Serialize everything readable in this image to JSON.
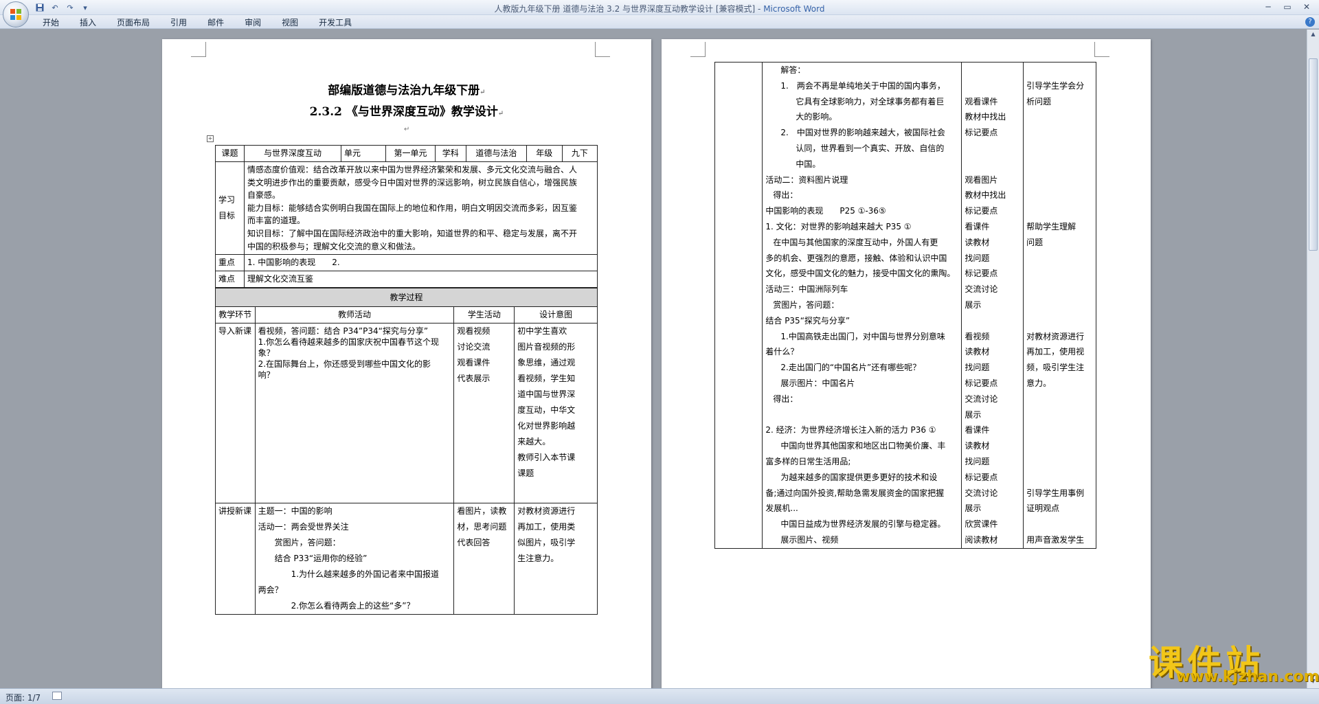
{
  "window": {
    "title_main": "人教版九年级下册 道德与法治 3.2 与世界深度互动教学设计 [兼容模式] - ",
    "title_brand": "Microsoft Word"
  },
  "menu": {
    "tabs": [
      "开始",
      "插入",
      "页面布局",
      "引用",
      "邮件",
      "审阅",
      "视图",
      "开发工具"
    ]
  },
  "status": {
    "page": "页面: 1/7"
  },
  "watermark": {
    "text": "课件站",
    "url": "www.kjzhan.com"
  },
  "page1": {
    "title": "部编版道德与法治九年级下册",
    "subtitle": "2.3.2 《与世界深度互动》教学设计",
    "table": {
      "topic_label": "课题",
      "topic_value": "与世界深度互动",
      "unit_label": "单元",
      "unit_value": "第一单元",
      "subject_label": "学科",
      "subject_value": "道德与法治",
      "grade_label": "年级",
      "grade_value": "九下",
      "goals_label_1": "学习",
      "goals_label_2": "目标",
      "goals": [
        "情感态度价值观：结合改革开放以来中国为世界经济繁荣和发展、多元文化交流与融合、人",
        "类文明进步作出的重要贡献，感受今日中国对世界的深远影响，树立民族自信心，增强民族",
        "自豪感。",
        "能力目标：能够结合实例明白我国在国际上的地位和作用，明白文明因交流而多彩，因互鉴",
        "而丰富的道理。",
        "知识目标：了解中国在国际经济政治中的重大影响，知道世界的和平、稳定与发展，离不开",
        "中国的积极参与；理解文化交流的意义和做法。"
      ],
      "key_label": "重点",
      "key_value": "1. 中国影响的表现　　2.",
      "diff_label": "难点",
      "diff_value": "理解文化交流互鉴",
      "process_header": "教学过程",
      "col_headers": [
        "教学环节",
        "教师活动",
        "学生活动",
        "设计意图"
      ],
      "row1": {
        "stage": "导入新课",
        "teacher": [
          "看视频，答问题：结合 P34”P34“探究与分享”",
          "1.你怎么看待越来越多的国家庆祝中国春节这个现",
          "象？",
          "2.在国际舞台上，你还感受到哪些中国文化的影",
          "响？",
          ""
        ],
        "student": [
          "观看视频",
          "讨论交流",
          "观看课件",
          "代表展示"
        ],
        "intent": [
          "初中学生喜欢",
          "图片音视频的形",
          "象思维，通过观",
          "看视频，学生知",
          "道中国与世界深",
          "度互动，中华文",
          "化对世界影响越",
          "来越大。",
          "教师引入本节课",
          "课题"
        ]
      },
      "row2": {
        "stage": "讲授新课",
        "teacher": [
          "主题一：中国的影响",
          "活动一：两会受世界关注",
          "　　赏图片，答问题：",
          "　　结合 P33“运用你的经验”",
          "　　　　1.为什么越来越多的外国记者来中国报道",
          "两会？",
          "　　　　2.你怎么看待两会上的这些“多”？"
        ],
        "student": [
          "看图片，读教",
          "材，思考问题",
          "代表回答",
          "",
          "",
          ""
        ],
        "intent": [
          "对教材资源进行",
          "再加工，使用类",
          "似图片，吸引学",
          "生注意力。",
          "",
          "",
          ""
        ]
      }
    }
  },
  "page2": {
    "rows": [
      {
        "t": "解答：",
        "i": 2,
        "s": "",
        "d": ""
      },
      {
        "t": "1.　两会不再是单纯地关于中国的国内事务，",
        "i": 2,
        "s": "",
        "d": "引导学生学会分"
      },
      {
        "t": "它具有全球影响力，对全球事务都有着巨",
        "i": 4,
        "s": "观看课件",
        "d": "析问题"
      },
      {
        "t": "大的影响。",
        "i": 4,
        "s": "教材中找出",
        "d": ""
      },
      {
        "t": "2.　中国对世界的影响越来越大，被国际社会",
        "i": 2,
        "s": "标记要点",
        "d": ""
      },
      {
        "t": "认同，世界看到一个真实、开放、自信的",
        "i": 4,
        "s": "",
        "d": ""
      },
      {
        "t": "中国。",
        "i": 4,
        "s": "",
        "d": ""
      },
      {
        "t": "活动二：资料图片说理",
        "i": 0,
        "s": "观看图片",
        "d": ""
      },
      {
        "t": "得出：",
        "i": 1,
        "s": "教材中找出",
        "d": ""
      },
      {
        "t": "中国影响的表现　　P25 ①-36⑤",
        "i": 0,
        "s": "标记要点",
        "d": ""
      },
      {
        "t": "1. 文化：对世界的影响越来越大 P35 ①",
        "i": 0,
        "s": "看课件",
        "d": "帮助学生理解"
      },
      {
        "t": "在中国与其他国家的深度互动中，外国人有更",
        "i": 1,
        "s": "读教材",
        "d": "问题"
      },
      {
        "t": "多的机会、更强烈的意愿，接触、体验和认识中国",
        "i": 0,
        "s": "找问题",
        "d": ""
      },
      {
        "t": "文化，感受中国文化的魅力，接受中国文化的熏陶。",
        "i": 0,
        "s": "标记要点",
        "d": ""
      },
      {
        "t": "活动三：中国洲际列车",
        "i": 0,
        "s": "交流讨论",
        "d": ""
      },
      {
        "t": "赏图片，答问题：",
        "i": 1,
        "s": "展示",
        "d": ""
      },
      {
        "t": "结合 P35“探究与分享”",
        "i": 0,
        "s": "",
        "d": ""
      },
      {
        "t": "1.中国高铁走出国门，对中国与世界分别意味",
        "i": 2,
        "s": "看视频",
        "d": "对教材资源进行"
      },
      {
        "t": "着什么？",
        "i": 0,
        "s": "读教材",
        "d": "再加工，使用视"
      },
      {
        "t": "2.走出国门的“中国名片”还有哪些呢？",
        "i": 2,
        "s": "找问题",
        "d": "频，吸引学生注"
      },
      {
        "t": "展示图片：中国名片",
        "i": 2,
        "s": "标记要点",
        "d": "意力。"
      },
      {
        "t": "得出：",
        "i": 1,
        "s": "交流讨论",
        "d": ""
      },
      {
        "t": "",
        "i": 0,
        "s": "展示",
        "d": ""
      },
      {
        "t": "2. 经济：为世界经济增长注入新的活力 P36 ①",
        "i": 0,
        "s": "看课件",
        "d": ""
      },
      {
        "t": "中国向世界其他国家和地区出口物美价廉、丰",
        "i": 2,
        "s": "读教材",
        "d": ""
      },
      {
        "t": "富多样的日常生活用品;",
        "i": 0,
        "s": "找问题",
        "d": ""
      },
      {
        "t": "为越来越多的国家提供更多更好的技术和设",
        "i": 2,
        "s": "标记要点",
        "d": ""
      },
      {
        "t": "备;通过向国外投资,帮助急需发展资金的国家把握",
        "i": 0,
        "s": "交流讨论",
        "d": "引导学生用事例"
      },
      {
        "t": "发展机...",
        "i": 0,
        "s": "展示",
        "d": "证明观点"
      },
      {
        "t": "中国日益成为世界经济发展的引擎与稳定器。",
        "i": 2,
        "s": "欣赏课件",
        "d": ""
      },
      {
        "t": "展示图片、视频",
        "i": 2,
        "s": "阅读教材",
        "d": "用声音激发学生"
      }
    ]
  }
}
